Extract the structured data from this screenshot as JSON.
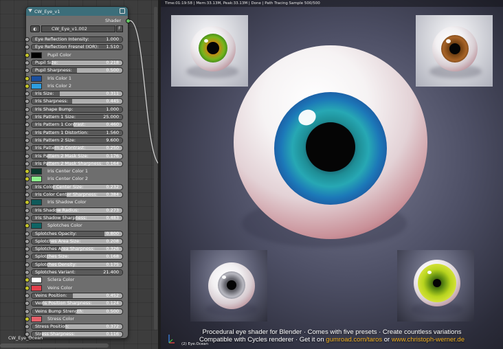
{
  "node_editor": {
    "footer_label": "CW_Eye_Ocean",
    "node": {
      "title": "CW_Eye_v1",
      "output_label": "Shader",
      "datablock_name": "CW_Eye_v1.002",
      "fake_user_label": "F",
      "inputs": [
        {
          "type": "float",
          "label": "Eye Reflection Intensity:",
          "value": "1.000",
          "fill": 1.0
        },
        {
          "type": "float",
          "label": "Eye Reflection Fresnel (IOR):",
          "value": "1.510",
          "fill": 1.0
        },
        {
          "type": "color",
          "label": "Pupil Color",
          "color": "#000000"
        },
        {
          "type": "float",
          "label": "Pupil Size:",
          "value": "0.218",
          "fill": 0.218
        },
        {
          "type": "float",
          "label": "Pupil Sharpness:",
          "value": "0.500",
          "fill": 0.5
        },
        {
          "type": "color",
          "label": "Iris Color 1",
          "color": "#1b4f9e"
        },
        {
          "type": "color",
          "label": "Iris Color 2",
          "color": "#2e9ee0"
        },
        {
          "type": "float",
          "label": "Iris Size:",
          "value": "0.311",
          "fill": 0.311
        },
        {
          "type": "float",
          "label": "Iris Sharpness:",
          "value": "0.445",
          "fill": 0.445
        },
        {
          "type": "float",
          "label": "Iris Shape Bump:",
          "value": "1.000",
          "fill": 1.0
        },
        {
          "type": "float",
          "label": "Iris Pattern 1 Size:",
          "value": "25.000",
          "fill": 1.0
        },
        {
          "type": "float",
          "label": "Iris Pattern 1 Contrast:",
          "value": "0.460",
          "fill": 0.46
        },
        {
          "type": "float",
          "label": "Iris Pattern 1 Distortion:",
          "value": "1.560",
          "fill": 1.0
        },
        {
          "type": "float",
          "label": "Iris Pattern 2 Size:",
          "value": "9.600",
          "fill": 1.0
        },
        {
          "type": "float",
          "label": "Iris Pattern 2 Contrast:",
          "value": "0.250",
          "fill": 0.25
        },
        {
          "type": "float",
          "label": "Iris Pattern 2 Mask Size:",
          "value": "0.176",
          "fill": 0.176
        },
        {
          "type": "float",
          "label": "Iris Pattern 2 Mask Sharpness:",
          "value": "0.164",
          "fill": 0.164
        },
        {
          "type": "color",
          "label": "Iris Center Color 1",
          "color": "#0b3a2e"
        },
        {
          "type": "color",
          "label": "Iris Center Color 2",
          "color": "#8cf08c"
        },
        {
          "type": "float",
          "label": "Iris Color Center Size:",
          "value": "0.232",
          "fill": 0.232
        },
        {
          "type": "float",
          "label": "Iris Color Center Sharpness:",
          "value": "0.384",
          "fill": 0.384
        },
        {
          "type": "color",
          "label": "Iris Shadow Color",
          "color": "#0f5a5a"
        },
        {
          "type": "float",
          "label": "Iris Shadow Radius:",
          "value": "0.273",
          "fill": 0.273
        },
        {
          "type": "float",
          "label": "Iris Shadow Sharpness:",
          "value": "0.483",
          "fill": 0.483
        },
        {
          "type": "color",
          "label": "Splotches Color",
          "color": "#0e6464"
        },
        {
          "type": "float",
          "label": "Splotches Opacity:",
          "value": "0.800",
          "fill": 0.8
        },
        {
          "type": "float",
          "label": "Splotches Area Size:",
          "value": "0.208",
          "fill": 0.208
        },
        {
          "type": "float",
          "label": "Splotches Area Sharpness:",
          "value": "0.326",
          "fill": 0.326
        },
        {
          "type": "float",
          "label": "Splotches Size:",
          "value": "0.168",
          "fill": 0.168
        },
        {
          "type": "float",
          "label": "Splotches Density:",
          "value": "0.175",
          "fill": 0.175
        },
        {
          "type": "float",
          "label": "Splotches Variant:",
          "value": "21.400",
          "fill": 1.0
        },
        {
          "type": "color",
          "label": "Sclera Color",
          "color": "#ffffff"
        },
        {
          "type": "color",
          "label": "Veins Color",
          "color": "#e3404c"
        },
        {
          "type": "float",
          "label": "Veins Position:",
          "value": "0.452",
          "fill": 0.452
        },
        {
          "type": "float",
          "label": "Veins Position Sharpness:",
          "value": "0.124",
          "fill": 0.124
        },
        {
          "type": "float",
          "label": "Veins Bump Strength:",
          "value": "0.500",
          "fill": 0.5
        },
        {
          "type": "color",
          "label": "Stress Color",
          "color": "#e6606a"
        },
        {
          "type": "float",
          "label": "Stress Position:",
          "value": "0.372",
          "fill": 0.372
        },
        {
          "type": "float",
          "label": "Stress Sharpness:",
          "value": "0.116",
          "fill": 0.116
        }
      ]
    }
  },
  "render": {
    "status": "Time:01:19:58 | Mem:33.13M, Peak:33.13M | Done | Path Tracing Sample 500/500",
    "object_name": "(2) Eye.Ocean",
    "caption_line1": "Procedural eye shader for Blender · Comes with five presets · Create countless variations",
    "caption_line2_prefix": "Compatible with Cycles renderer · Get it on ",
    "caption_link1": "gumroad.com/taros",
    "caption_or": " or ",
    "caption_link2": "www.christoph-werner.de",
    "accent_link_color": "#f2b01e"
  }
}
